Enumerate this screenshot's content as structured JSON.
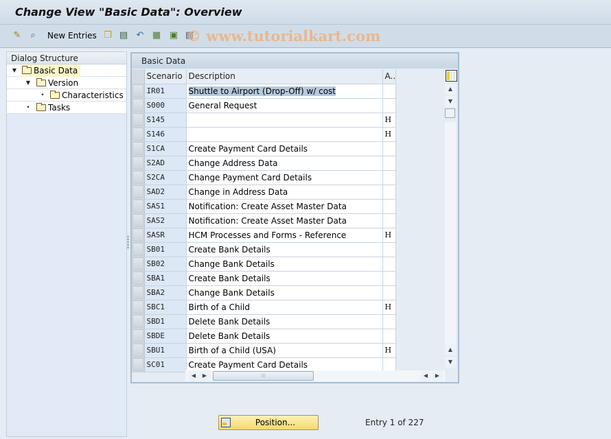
{
  "window": {
    "title": "Change View \"Basic Data\": Overview"
  },
  "toolbar": {
    "new_entries_label": "New Entries",
    "watermark": "© www.tutorialkart.com",
    "icons": [
      "display-change-icon",
      "where-used-icon",
      "copy-icon",
      "delete-icon",
      "undo-change-icon",
      "select-all-icon",
      "select-block-icon",
      "deselect-all-icon"
    ]
  },
  "dialog_structure": {
    "header": "Dialog Structure",
    "items": [
      {
        "label": "Basic Data",
        "level": 0,
        "expanded": true,
        "selected": true
      },
      {
        "label": "Version",
        "level": 1,
        "expanded": true,
        "selected": false
      },
      {
        "label": "Characteristics",
        "level": 2,
        "leaf": true,
        "selected": false
      },
      {
        "label": "Tasks",
        "level": 1,
        "leaf": true,
        "selected": false
      }
    ]
  },
  "table": {
    "caption": "Basic Data",
    "columns": [
      "Scenario",
      "Description",
      "A.."
    ],
    "rows": [
      {
        "scenario": "IR01",
        "description": "Shuttle to Airport  (Drop-Off) w/ cost",
        "attr": "",
        "highlighted": true
      },
      {
        "scenario": "S000",
        "description": "General Request",
        "attr": ""
      },
      {
        "scenario": "S145",
        "description": "",
        "attr": "H"
      },
      {
        "scenario": "S146",
        "description": "",
        "attr": "H"
      },
      {
        "scenario": "S1CA",
        "description": "Create Payment Card Details",
        "attr": ""
      },
      {
        "scenario": "S2AD",
        "description": "Change Address Data",
        "attr": ""
      },
      {
        "scenario": "S2CA",
        "description": "Change Payment Card Details",
        "attr": ""
      },
      {
        "scenario": "SAD2",
        "description": "Change in Address Data",
        "attr": ""
      },
      {
        "scenario": "SAS1",
        "description": "Notification: Create Asset Master Data",
        "attr": ""
      },
      {
        "scenario": "SAS2",
        "description": "Notification: Create Asset Master Data",
        "attr": ""
      },
      {
        "scenario": "SASR",
        "description": "HCM Processes and Forms - Reference",
        "attr": "H"
      },
      {
        "scenario": "SB01",
        "description": "Create Bank Details",
        "attr": ""
      },
      {
        "scenario": "SB02",
        "description": "Change Bank Details",
        "attr": ""
      },
      {
        "scenario": "SBA1",
        "description": "Create Bank Details",
        "attr": ""
      },
      {
        "scenario": "SBA2",
        "description": "Change Bank Details",
        "attr": ""
      },
      {
        "scenario": "SBC1",
        "description": "Birth of a Child",
        "attr": "H"
      },
      {
        "scenario": "SBD1",
        "description": "Delete Bank Details",
        "attr": ""
      },
      {
        "scenario": "SBDE",
        "description": "Delete Bank Details",
        "attr": ""
      },
      {
        "scenario": "SBU1",
        "description": "Birth of a Child (USA)",
        "attr": "H"
      },
      {
        "scenario": "SC01",
        "description": "Create Payment Card Details",
        "attr": ""
      }
    ]
  },
  "footer": {
    "position_button": "Position...",
    "entry_info": "Entry 1 of 227"
  }
}
